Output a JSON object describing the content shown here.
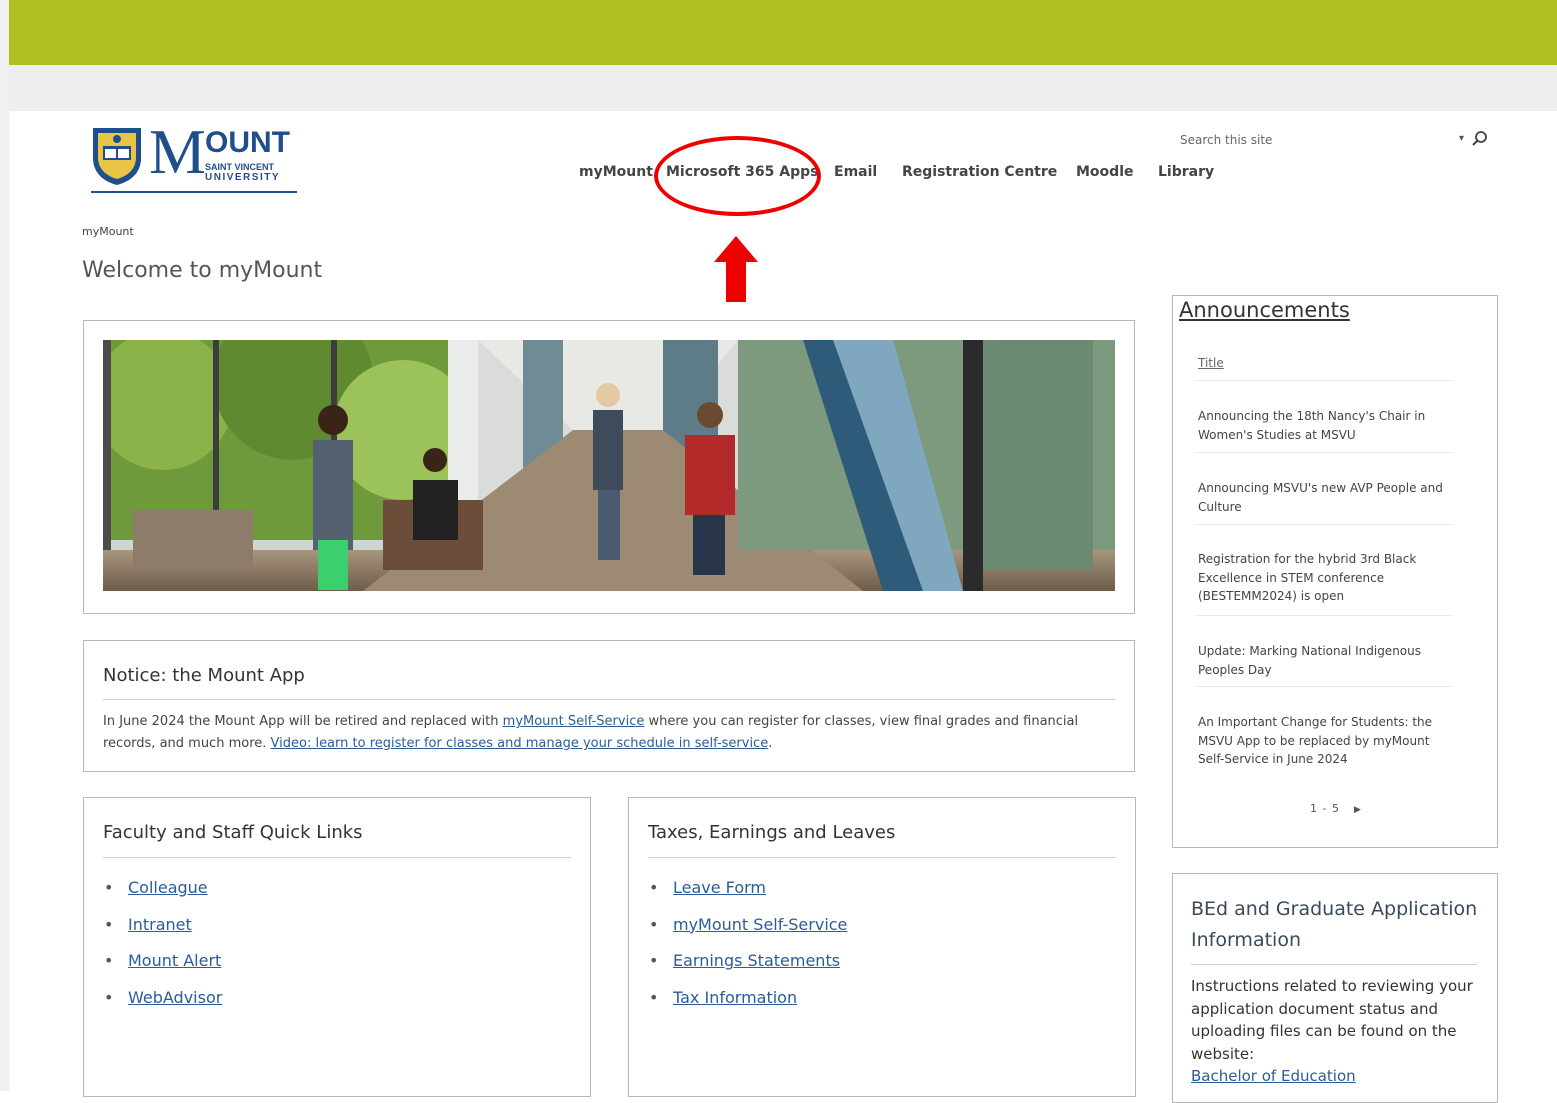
{
  "logo": {
    "letter_m": "M",
    "ount": "OUNT",
    "line1": "SAINT VINCENT",
    "line2": "UNIVERSITY"
  },
  "nav": {
    "items": [
      {
        "label": "myMount"
      },
      {
        "label": "Microsoft 365 Apps"
      },
      {
        "label": "Email"
      },
      {
        "label": "Registration Centre"
      },
      {
        "label": "Moodle"
      },
      {
        "label": "Library"
      }
    ]
  },
  "search": {
    "placeholder": "Search this site",
    "caret": "▾"
  },
  "breadcrumb": "myMount",
  "page_title": "Welcome to myMount",
  "notice": {
    "title": "Notice: the Mount App",
    "text_before": "In June 2024 the Mount App will be retired and replaced with ",
    "link1": "myMount Self-Service",
    "text_middle": " where you can register for classes, view final grades and financial records, and much more. ",
    "link2": "Video: learn to register for classes and manage your schedule in self-service",
    "text_after": "."
  },
  "quick_links": {
    "title": "Faculty and Staff Quick Links",
    "items": [
      "Colleague",
      "Intranet",
      "Mount Alert",
      "WebAdvisor"
    ]
  },
  "taxes": {
    "title": "Taxes, Earnings and Leaves",
    "items": [
      "Leave Form",
      "myMount Self-Service",
      "Earnings Statements",
      "Tax Information"
    ]
  },
  "announcements": {
    "title": "Announcements",
    "column": "Title",
    "items": [
      "Announcing the 18th Nancy's Chair in Women's Studies at MSVU",
      "Announcing MSVU's new AVP People and Culture",
      "Registration for the hybrid 3rd Black Excellence in STEM conference (BESTEMM2024) is open",
      "Update: Marking National Indigenous Peoples Day",
      "An Important Change for Students: the MSVU App to be replaced by myMount Self-Service in June 2024"
    ],
    "pager": "1 - 5",
    "pager_next": "▶"
  },
  "bed": {
    "title": "BEd and Graduate Application Information",
    "text": "Instructions related to reviewing your application document status and uploading files can be found on the website:",
    "link": "Bachelor of Education"
  },
  "colors": {
    "top_bar": "#afbe22",
    "annotation": "#ee0000",
    "link": "#2a5d99",
    "brand": "#1f4e8c"
  }
}
